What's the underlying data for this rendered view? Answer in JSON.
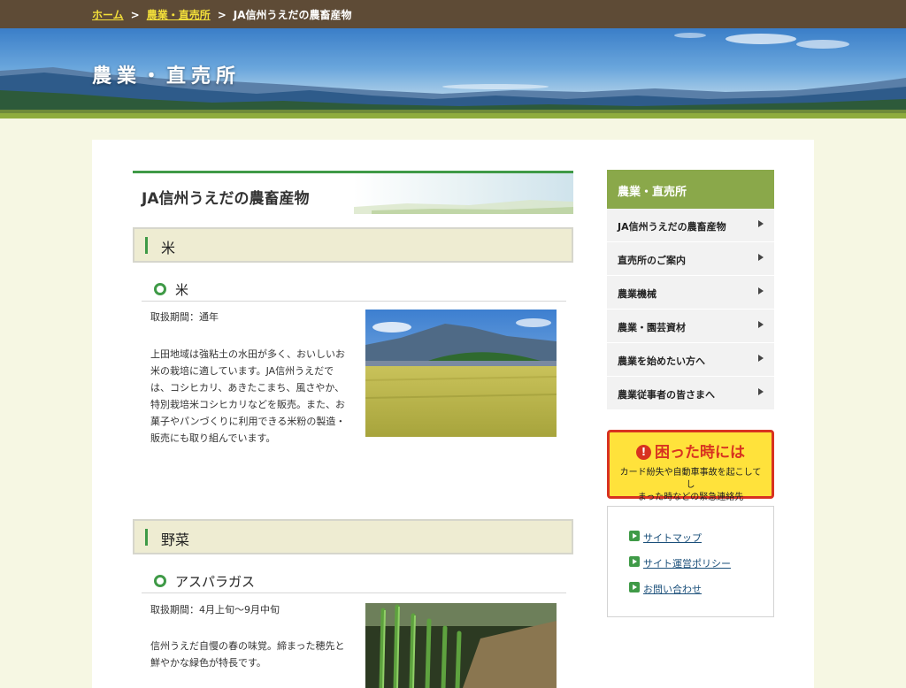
{
  "breadcrumb": {
    "items": [
      "ホーム",
      "農業・直売所"
    ],
    "current": "JA信州うえだの農畜産物",
    "separator": ">"
  },
  "hero": {
    "title": "農業・直売所"
  },
  "page": {
    "heading": "JA信州うえだの農畜産物",
    "sections": [
      {
        "category": "米",
        "item": "米",
        "period": "取扱期間：通年",
        "description_lines": [
          "上田地域は強粘土の水田が多く、おいしいお",
          "米の栽培に適しています。JA信州うえだで",
          "は、コシヒカリ、あきたこまち、風さやか、",
          "特別栽培米コシヒカリなどを販売。また、お",
          "菓子やパンづくりに利用できる米粉の製造・",
          "販売にも取り組んでいます。"
        ]
      },
      {
        "category": "野菜",
        "item": "アスパラガス",
        "period": "取扱期間：4月上旬〜9月中旬",
        "description_lines": [
          "信州うえだ自慢の春の味覚。締まった穂先と",
          "鮮やかな緑色が特長です。"
        ]
      }
    ]
  },
  "sidebar": {
    "title": "農業・直売所",
    "items": [
      "JA信州うえだの農畜産物",
      "直売所のご案内",
      "農業機械",
      "農業・園芸資材",
      "農業を始めたい方へ",
      "農業従事者の皆さまへ"
    ]
  },
  "alert": {
    "icon": "!",
    "title": "困った時には",
    "desc_lines": [
      "カード紛失や自動車事故を起こしてし",
      "まった時などの緊急連絡先"
    ]
  },
  "links": [
    "サイトマップ",
    "サイト運営ポリシー",
    "お問い合わせ"
  ],
  "colors": {
    "accent_green": "#3f9a47",
    "breadcrumb_bg": "#5e4b36",
    "alert_red": "#d83220",
    "alert_yellow": "#ffe23b"
  }
}
